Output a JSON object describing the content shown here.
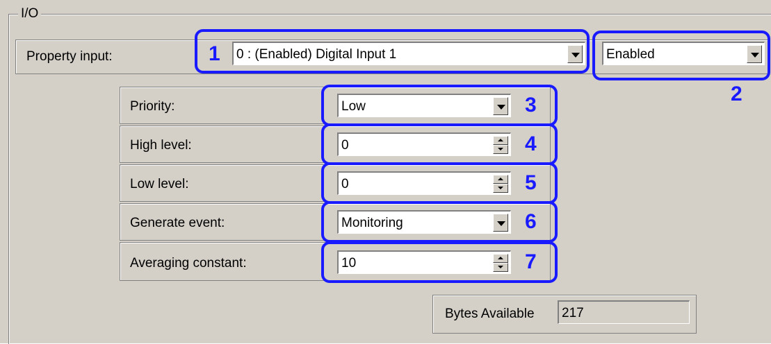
{
  "group": {
    "title": "I/O"
  },
  "property_input": {
    "label": "Property input:",
    "input_value": "0 : (Enabled) Digital Input 1",
    "state_value": "Enabled"
  },
  "rows": [
    {
      "label": "Priority:",
      "value": "Low",
      "control": "dropdown",
      "callout": "3"
    },
    {
      "label": "High level:",
      "value": "0",
      "control": "spinner",
      "callout": "4"
    },
    {
      "label": "Low level:",
      "value": "0",
      "control": "spinner",
      "callout": "5"
    },
    {
      "label": "Generate event:",
      "value": "Monitoring",
      "control": "dropdown",
      "callout": "6"
    },
    {
      "label": "Averaging constant:",
      "value": "10",
      "control": "spinner",
      "callout": "7"
    }
  ],
  "callouts": {
    "input": "1",
    "state": "2"
  },
  "bytes": {
    "label": "Bytes Available",
    "value": "217"
  },
  "colors": {
    "highlight": "#1a1aff",
    "panel": "#d4d0c8"
  }
}
